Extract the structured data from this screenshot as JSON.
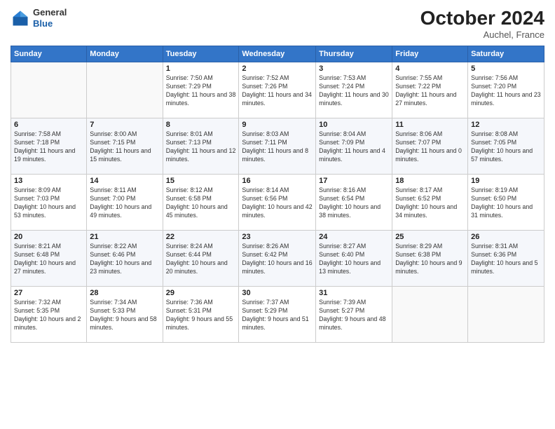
{
  "header": {
    "logo_general": "General",
    "logo_blue": "Blue",
    "month_title": "October 2024",
    "location": "Auchel, France"
  },
  "days_of_week": [
    "Sunday",
    "Monday",
    "Tuesday",
    "Wednesday",
    "Thursday",
    "Friday",
    "Saturday"
  ],
  "weeks": [
    [
      {
        "day": "",
        "info": ""
      },
      {
        "day": "",
        "info": ""
      },
      {
        "day": "1",
        "info": "Sunrise: 7:50 AM\nSunset: 7:29 PM\nDaylight: 11 hours and 38 minutes."
      },
      {
        "day": "2",
        "info": "Sunrise: 7:52 AM\nSunset: 7:26 PM\nDaylight: 11 hours and 34 minutes."
      },
      {
        "day": "3",
        "info": "Sunrise: 7:53 AM\nSunset: 7:24 PM\nDaylight: 11 hours and 30 minutes."
      },
      {
        "day": "4",
        "info": "Sunrise: 7:55 AM\nSunset: 7:22 PM\nDaylight: 11 hours and 27 minutes."
      },
      {
        "day": "5",
        "info": "Sunrise: 7:56 AM\nSunset: 7:20 PM\nDaylight: 11 hours and 23 minutes."
      }
    ],
    [
      {
        "day": "6",
        "info": "Sunrise: 7:58 AM\nSunset: 7:18 PM\nDaylight: 11 hours and 19 minutes."
      },
      {
        "day": "7",
        "info": "Sunrise: 8:00 AM\nSunset: 7:15 PM\nDaylight: 11 hours and 15 minutes."
      },
      {
        "day": "8",
        "info": "Sunrise: 8:01 AM\nSunset: 7:13 PM\nDaylight: 11 hours and 12 minutes."
      },
      {
        "day": "9",
        "info": "Sunrise: 8:03 AM\nSunset: 7:11 PM\nDaylight: 11 hours and 8 minutes."
      },
      {
        "day": "10",
        "info": "Sunrise: 8:04 AM\nSunset: 7:09 PM\nDaylight: 11 hours and 4 minutes."
      },
      {
        "day": "11",
        "info": "Sunrise: 8:06 AM\nSunset: 7:07 PM\nDaylight: 11 hours and 0 minutes."
      },
      {
        "day": "12",
        "info": "Sunrise: 8:08 AM\nSunset: 7:05 PM\nDaylight: 10 hours and 57 minutes."
      }
    ],
    [
      {
        "day": "13",
        "info": "Sunrise: 8:09 AM\nSunset: 7:03 PM\nDaylight: 10 hours and 53 minutes."
      },
      {
        "day": "14",
        "info": "Sunrise: 8:11 AM\nSunset: 7:00 PM\nDaylight: 10 hours and 49 minutes."
      },
      {
        "day": "15",
        "info": "Sunrise: 8:12 AM\nSunset: 6:58 PM\nDaylight: 10 hours and 45 minutes."
      },
      {
        "day": "16",
        "info": "Sunrise: 8:14 AM\nSunset: 6:56 PM\nDaylight: 10 hours and 42 minutes."
      },
      {
        "day": "17",
        "info": "Sunrise: 8:16 AM\nSunset: 6:54 PM\nDaylight: 10 hours and 38 minutes."
      },
      {
        "day": "18",
        "info": "Sunrise: 8:17 AM\nSunset: 6:52 PM\nDaylight: 10 hours and 34 minutes."
      },
      {
        "day": "19",
        "info": "Sunrise: 8:19 AM\nSunset: 6:50 PM\nDaylight: 10 hours and 31 minutes."
      }
    ],
    [
      {
        "day": "20",
        "info": "Sunrise: 8:21 AM\nSunset: 6:48 PM\nDaylight: 10 hours and 27 minutes."
      },
      {
        "day": "21",
        "info": "Sunrise: 8:22 AM\nSunset: 6:46 PM\nDaylight: 10 hours and 23 minutes."
      },
      {
        "day": "22",
        "info": "Sunrise: 8:24 AM\nSunset: 6:44 PM\nDaylight: 10 hours and 20 minutes."
      },
      {
        "day": "23",
        "info": "Sunrise: 8:26 AM\nSunset: 6:42 PM\nDaylight: 10 hours and 16 minutes."
      },
      {
        "day": "24",
        "info": "Sunrise: 8:27 AM\nSunset: 6:40 PM\nDaylight: 10 hours and 13 minutes."
      },
      {
        "day": "25",
        "info": "Sunrise: 8:29 AM\nSunset: 6:38 PM\nDaylight: 10 hours and 9 minutes."
      },
      {
        "day": "26",
        "info": "Sunrise: 8:31 AM\nSunset: 6:36 PM\nDaylight: 10 hours and 5 minutes."
      }
    ],
    [
      {
        "day": "27",
        "info": "Sunrise: 7:32 AM\nSunset: 5:35 PM\nDaylight: 10 hours and 2 minutes."
      },
      {
        "day": "28",
        "info": "Sunrise: 7:34 AM\nSunset: 5:33 PM\nDaylight: 9 hours and 58 minutes."
      },
      {
        "day": "29",
        "info": "Sunrise: 7:36 AM\nSunset: 5:31 PM\nDaylight: 9 hours and 55 minutes."
      },
      {
        "day": "30",
        "info": "Sunrise: 7:37 AM\nSunset: 5:29 PM\nDaylight: 9 hours and 51 minutes."
      },
      {
        "day": "31",
        "info": "Sunrise: 7:39 AM\nSunset: 5:27 PM\nDaylight: 9 hours and 48 minutes."
      },
      {
        "day": "",
        "info": ""
      },
      {
        "day": "",
        "info": ""
      }
    ]
  ]
}
